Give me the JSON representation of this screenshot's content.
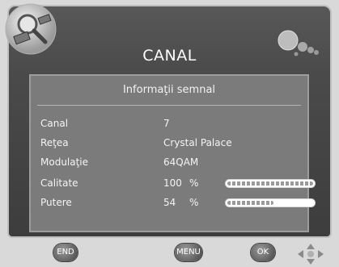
{
  "header": {
    "title": "CANAL"
  },
  "panel": {
    "subtitle": "Informaţii semnal",
    "rows": [
      {
        "label": "Canal",
        "value": "7"
      },
      {
        "label": "Reţea",
        "value": "Crystal Palace"
      },
      {
        "label": "Modulaţie",
        "value": "64QAM"
      },
      {
        "label": "Calitate",
        "value": "100",
        "unit": "%",
        "level_percent": 100
      },
      {
        "label": "Putere",
        "value": "54",
        "unit": "%",
        "level_percent": 54
      }
    ]
  },
  "buttons": {
    "end": "END",
    "menu": "MENU",
    "ok": "OK"
  },
  "icons": {
    "top_left": "search-satellite-icon",
    "top_right": "bubbles-icon",
    "nav": "direction-pad-icon"
  }
}
